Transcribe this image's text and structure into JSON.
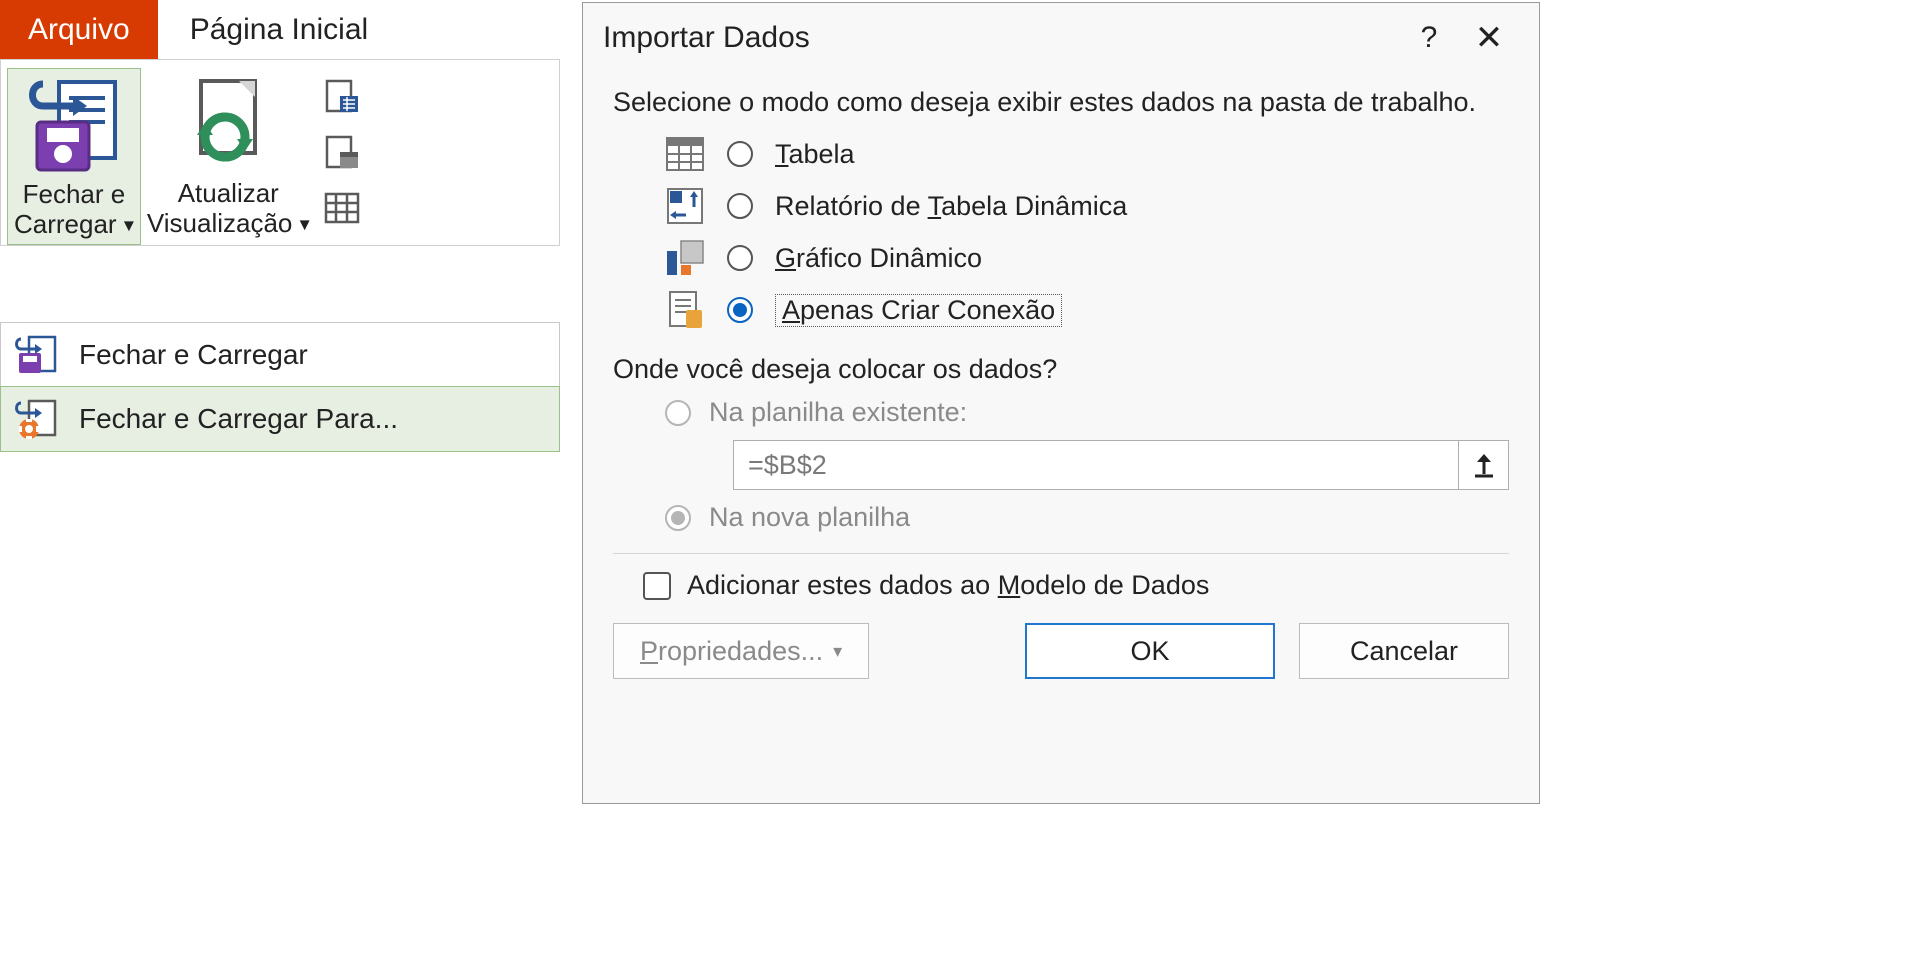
{
  "ribbon": {
    "tabs": {
      "file": "Arquivo",
      "home": "Página Inicial"
    },
    "close_load": {
      "label_line1": "Fechar e",
      "label_line2": "Carregar"
    },
    "refresh": {
      "label_line1": "Atualizar",
      "label_line2": "Visualização"
    },
    "dropdown": {
      "item1": "Fechar e Carregar",
      "item2": "Fechar e Carregar Para..."
    }
  },
  "dialog": {
    "title": "Importar Dados",
    "help": "?",
    "close": "✕",
    "prompt": "Selecione o modo como deseja exibir estes dados na pasta de trabalho.",
    "options": {
      "table_pre": "T",
      "table_post": "abela",
      "pivot_pre": "Relatório de ",
      "pivot_u": "T",
      "pivot_post": "abela Dinâmica",
      "chart_u": "G",
      "chart_post": "ráfico Dinâmico",
      "conn_u": "A",
      "conn_post": "penas Criar Conexão"
    },
    "place_prompt": "Onde você deseja colocar os dados?",
    "place_existing": "Na planilha existente:",
    "place_new": "Na nova planilha",
    "cell_ref": "=$B$2",
    "model_pre": "Adicionar estes dados ao ",
    "model_u": "M",
    "model_post": "odelo de Dados",
    "props_u": "P",
    "props_post": "ropriedades...",
    "ok": "OK",
    "cancel": "Cancelar"
  }
}
